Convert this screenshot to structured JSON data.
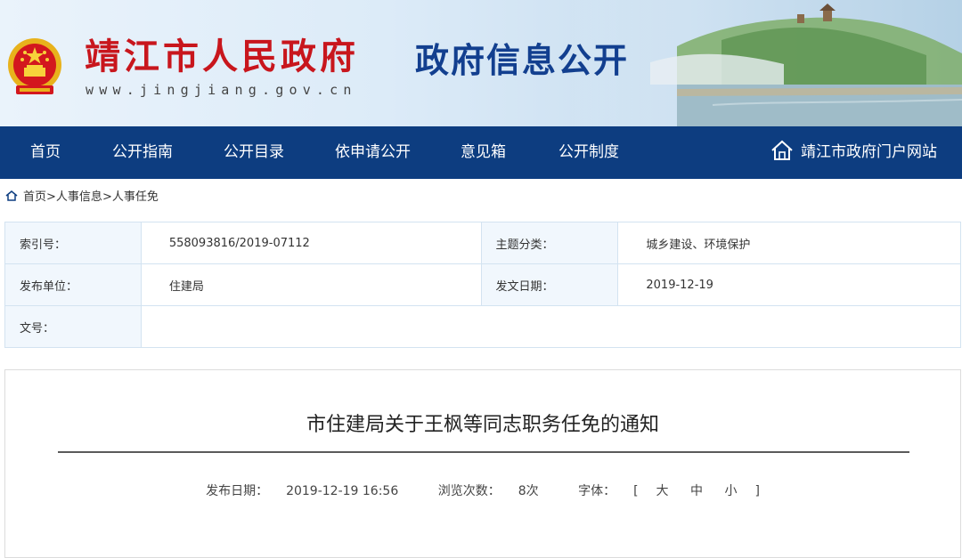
{
  "header": {
    "site_name": "靖江市人民政府",
    "site_url": "www.jingjiang.gov.cn",
    "section_title": "政府信息公开"
  },
  "nav": {
    "items": [
      "首页",
      "公开指南",
      "公开目录",
      "依申请公开",
      "意见箱",
      "公开制度"
    ],
    "portal_link": "靖江市政府门户网站"
  },
  "breadcrumb": {
    "home": "首页",
    "sep1": ">",
    "level1": "人事信息",
    "sep2": ">",
    "level2": "人事任免"
  },
  "info": {
    "index_label": "索引号：",
    "index_value": "558093816/2019-07112",
    "topic_label": "主题分类：",
    "topic_value": "城乡建设、环境保护",
    "publisher_label": "发布单位：",
    "publisher_value": "住建局",
    "date_label": "发文日期：",
    "date_value": "2019-12-19",
    "docno_label": "文号：",
    "docno_value": ""
  },
  "article": {
    "title": "市住建局关于王枫等同志职务任免的通知",
    "publish_label": "发布日期：",
    "publish_value": "2019-12-19 16:56",
    "views_label": "浏览次数：",
    "views_value": "8次",
    "font_label": "字体：",
    "font_open": "[",
    "font_large": "大",
    "font_medium": "中",
    "font_small": "小",
    "font_close": "]"
  },
  "colors": {
    "nav_bg": "#0d3d80",
    "site_name": "#c8161d",
    "section_title": "#123f8f"
  }
}
